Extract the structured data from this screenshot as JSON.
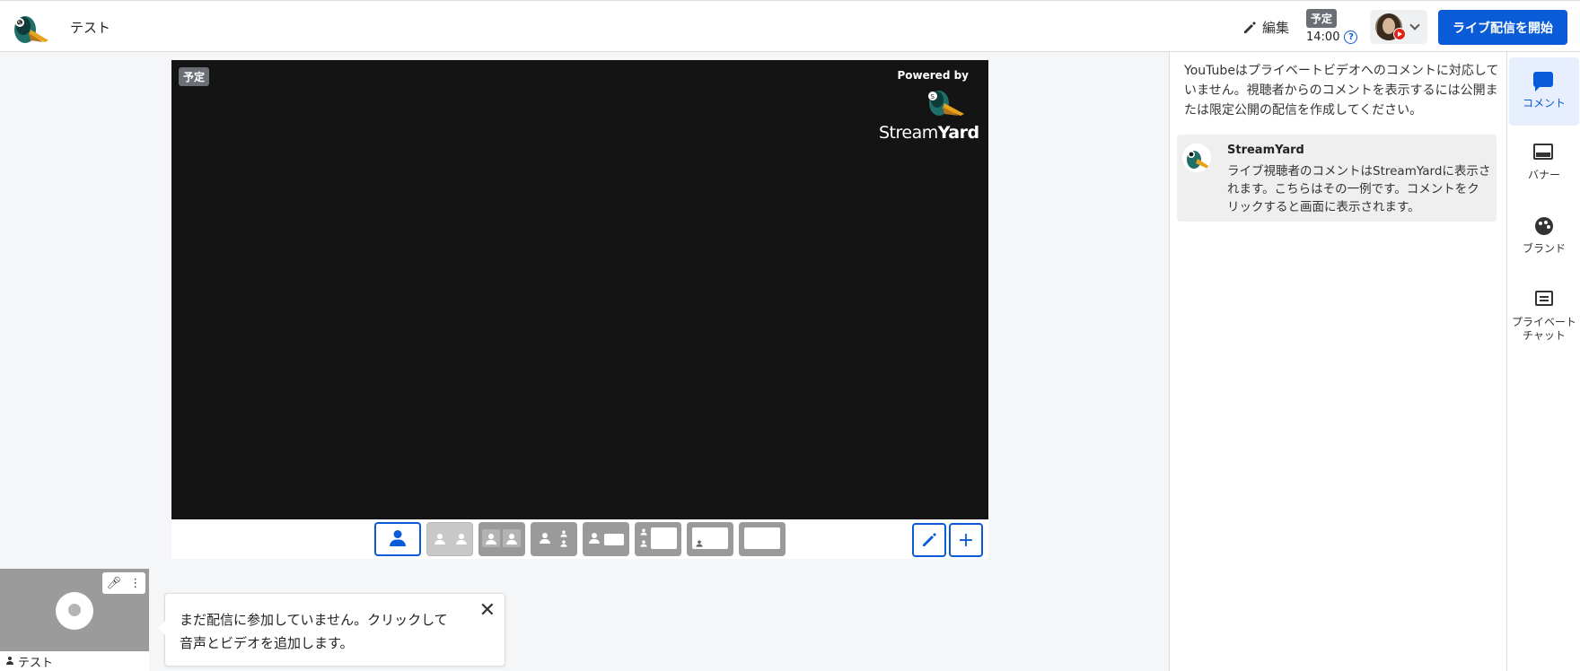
{
  "header": {
    "title": "テスト",
    "edit_label": "編集",
    "schedule_badge": "予定",
    "schedule_time": "14:00",
    "go_live_label": "ライブ配信を開始"
  },
  "stage": {
    "badge": "予定",
    "powered_by": "Powered by",
    "brand_light": "Stream",
    "brand_bold": "Yard"
  },
  "layouts": [
    {
      "name": "solo"
    },
    {
      "name": "cropped"
    },
    {
      "name": "group"
    },
    {
      "name": "leader"
    },
    {
      "name": "screen"
    },
    {
      "name": "thin"
    },
    {
      "name": "pip"
    },
    {
      "name": "full-screen"
    }
  ],
  "self_preview": {
    "name": "テスト"
  },
  "tooltip": {
    "text_line1": "まだ配信に参加していません。クリックして",
    "text_line2": "音声とビデオを追加します。"
  },
  "comments_panel": {
    "notice": "YouTubeはプライベートビデオへのコメントに対応していません。視聴者からのコメントを表示するには公開または限定公開の配信を作成してください。",
    "sample_author": "StreamYard",
    "sample_text": "ライブ視聴者のコメントはStreamYardに表示されます。こちらはその一例です。コメントをクリックすると画面に表示されます。"
  },
  "side_nav": {
    "comments": "コメント",
    "banners": "バナー",
    "brand": "ブランド",
    "private_chat_line1": "プライベート",
    "private_chat_line2": "チャット"
  },
  "colors": {
    "accent": "#0a5bd8",
    "stage_bg": "#141414",
    "badge_bg": "#6b6f75"
  }
}
